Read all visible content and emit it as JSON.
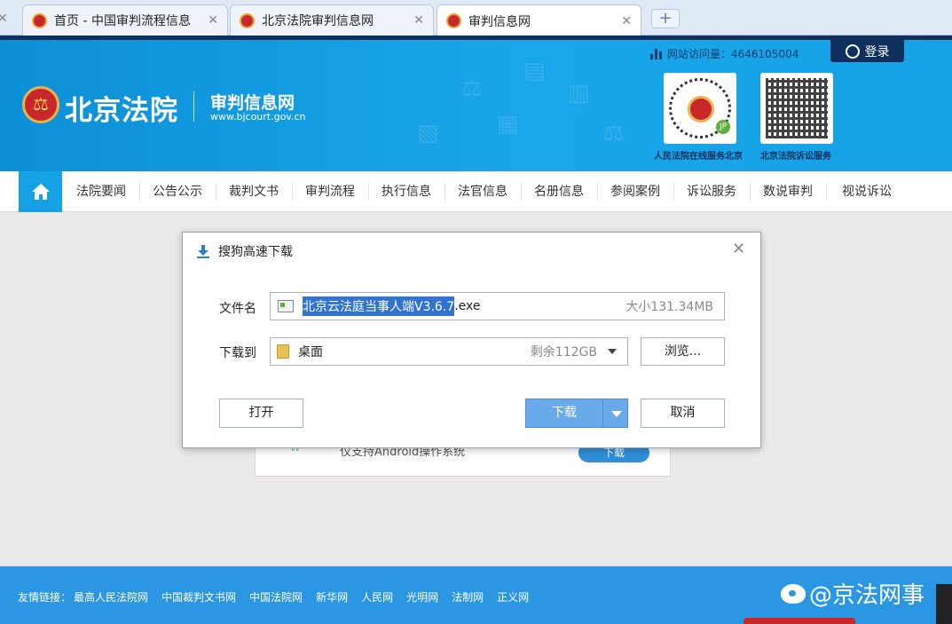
{
  "browser": {
    "tabs": [
      {
        "label": "首页 - 中国审判流程信息"
      },
      {
        "label": "北京法院审判信息网"
      },
      {
        "label": "审判信息网"
      }
    ],
    "new_tab_label": "+",
    "close_glyph": "✕"
  },
  "header": {
    "visits_label": "网站访问量：4646105004",
    "login_label": "登录",
    "site_name": "北京法院",
    "site_subtitle": "审判信息网",
    "site_url": "www.bjcourt.gov.cn",
    "qr_left_caption": "人民法院在线服务北京",
    "qr_right_caption": "北京法院诉讼服务",
    "brand_color": "#17a1e5"
  },
  "nav": {
    "items": [
      "法院要闻",
      "公告公示",
      "裁判文书",
      "审判流程",
      "执行信息",
      "法官信息",
      "名册信息",
      "参阅案例",
      "诉讼服务",
      "数说审判",
      "视说诉讼"
    ]
  },
  "background_card": {
    "text": "仅支持Android操作系统",
    "button_label": "下载"
  },
  "dialog": {
    "title": "搜狗高速下载",
    "close_glyph": "✕",
    "filename_label": "文件名",
    "filename_selected": "北京云法庭当事人端V3.6.7",
    "filename_ext": ".exe",
    "size_text": "大小131.34MB",
    "saveto_label": "下载到",
    "folder": "桌面",
    "free_space": "剩余112GB",
    "browse_label": "浏览...",
    "open_label": "打开",
    "download_label": "下载",
    "cancel_label": "取消",
    "primary_color": "#6aa9ea"
  },
  "footer": {
    "links_prefix": "友情链接：",
    "links": [
      "最高人民法院网",
      "中国裁判文书网",
      "中国法院网",
      "新华网",
      "人民网",
      "光明网",
      "法制网",
      "正义网"
    ],
    "watermark": "@京法网事"
  }
}
